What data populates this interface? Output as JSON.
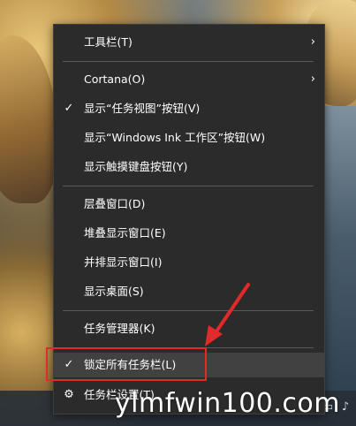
{
  "menu": {
    "items": [
      {
        "label": "工具栏(T)",
        "has_submenu": true,
        "checked": false,
        "highlighted": false
      },
      {
        "label": "Cortana(O)",
        "has_submenu": true,
        "checked": false,
        "highlighted": false
      },
      {
        "label": "显示“任务视图”按钮(V)",
        "has_submenu": false,
        "checked": true,
        "highlighted": false
      },
      {
        "label": "显示“Windows Ink 工作区”按钮(W)",
        "has_submenu": false,
        "checked": false,
        "highlighted": false
      },
      {
        "label": "显示触摸键盘按钮(Y)",
        "has_submenu": false,
        "checked": false,
        "highlighted": false
      },
      {
        "label": "层叠窗口(D)",
        "has_submenu": false,
        "checked": false,
        "highlighted": false
      },
      {
        "label": "堆叠显示窗口(E)",
        "has_submenu": false,
        "checked": false,
        "highlighted": false
      },
      {
        "label": "并排显示窗口(I)",
        "has_submenu": false,
        "checked": false,
        "highlighted": false
      },
      {
        "label": "显示桌面(S)",
        "has_submenu": false,
        "checked": false,
        "highlighted": false
      },
      {
        "label": "任务管理器(K)",
        "has_submenu": false,
        "checked": false,
        "highlighted": false
      },
      {
        "label": "锁定所有任务栏(L)",
        "has_submenu": false,
        "checked": true,
        "highlighted": true
      },
      {
        "label": "任务栏设置(T)",
        "has_submenu": false,
        "checked": false,
        "highlighted": false,
        "icon": "gear-icon"
      }
    ],
    "check_glyph": "✓",
    "chevron_glyph": "›",
    "gear_glyph": "⚙"
  },
  "annotation": {
    "box_color": "#e22a2a",
    "arrow_color": "#e22a2a"
  },
  "watermark": {
    "text": "ylmfwin100.com"
  },
  "taskbar": {
    "tray_icons": [
      "notification-icon",
      "volume-icon"
    ]
  }
}
